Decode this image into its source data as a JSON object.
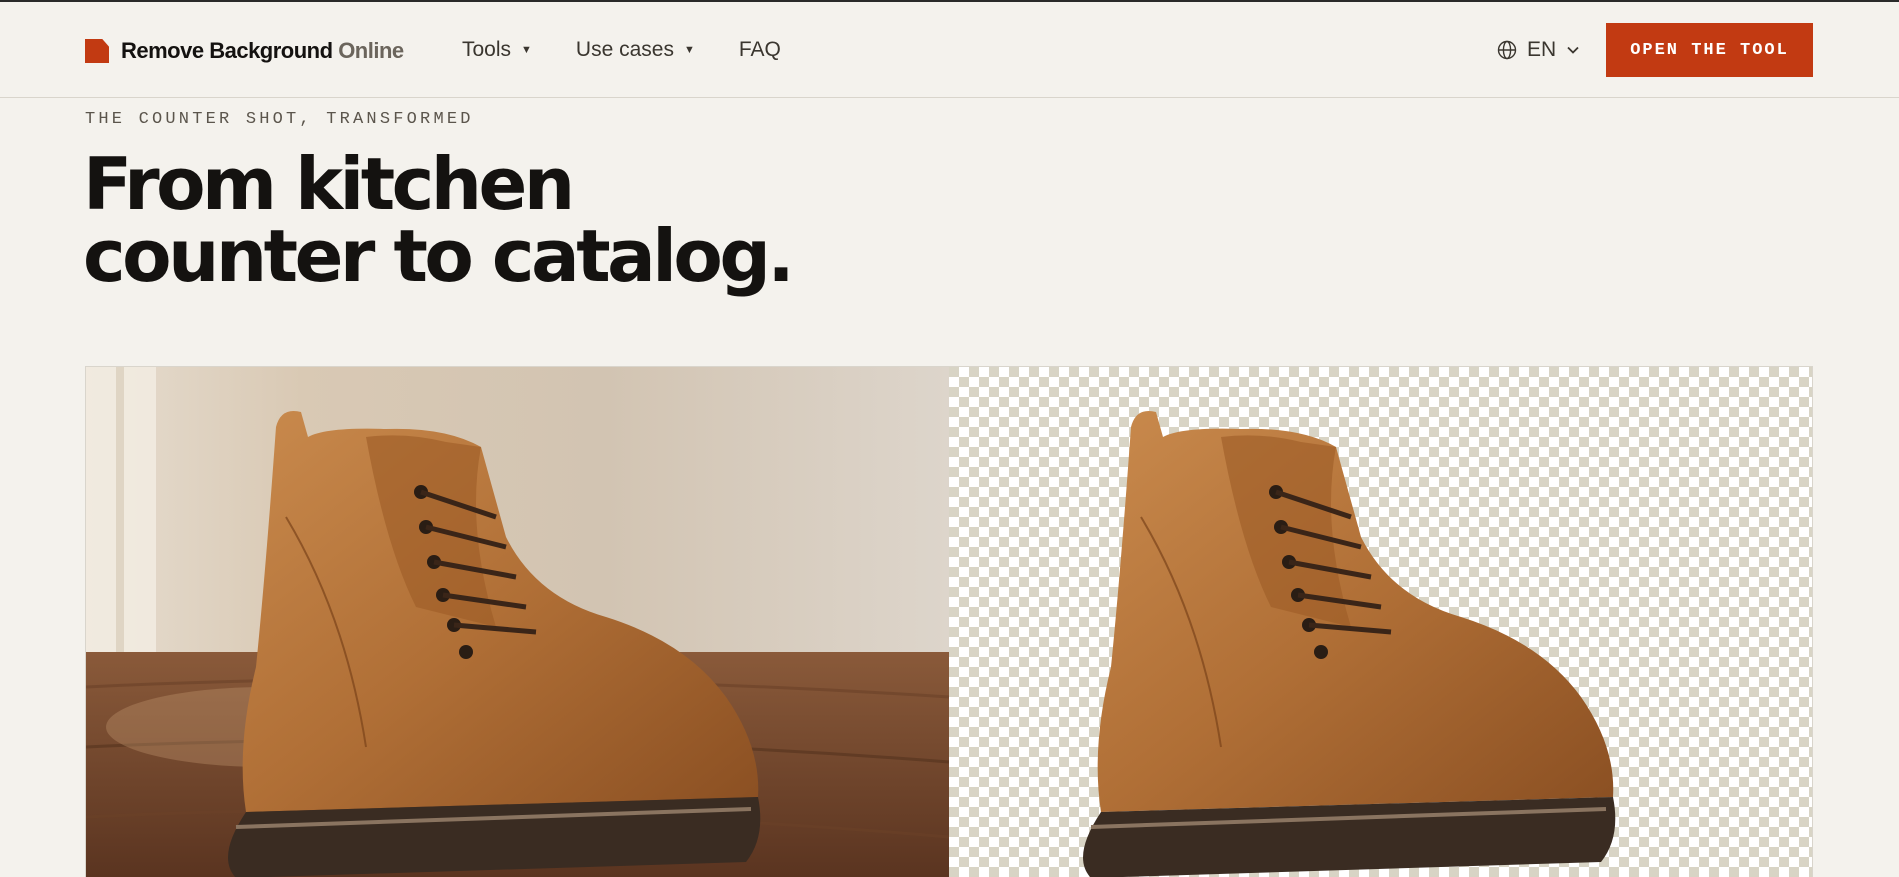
{
  "header": {
    "logo": {
      "brand": "Remove Background",
      "suffix": "Online"
    },
    "nav": [
      {
        "label": "Tools",
        "has_menu": true
      },
      {
        "label": "Use cases",
        "has_menu": true
      },
      {
        "label": "FAQ",
        "has_menu": false
      }
    ],
    "language": {
      "label": "EN"
    },
    "cta_label": "OPEN THE TOOL"
  },
  "hero": {
    "eyebrow": "THE COUNTER SHOT, TRANSFORMED",
    "headline_line1": "From kitchen",
    "headline_line2": "counter to catalog."
  },
  "colors": {
    "accent": "#c23a12",
    "background": "#f4f2ed",
    "text": "#141210"
  }
}
